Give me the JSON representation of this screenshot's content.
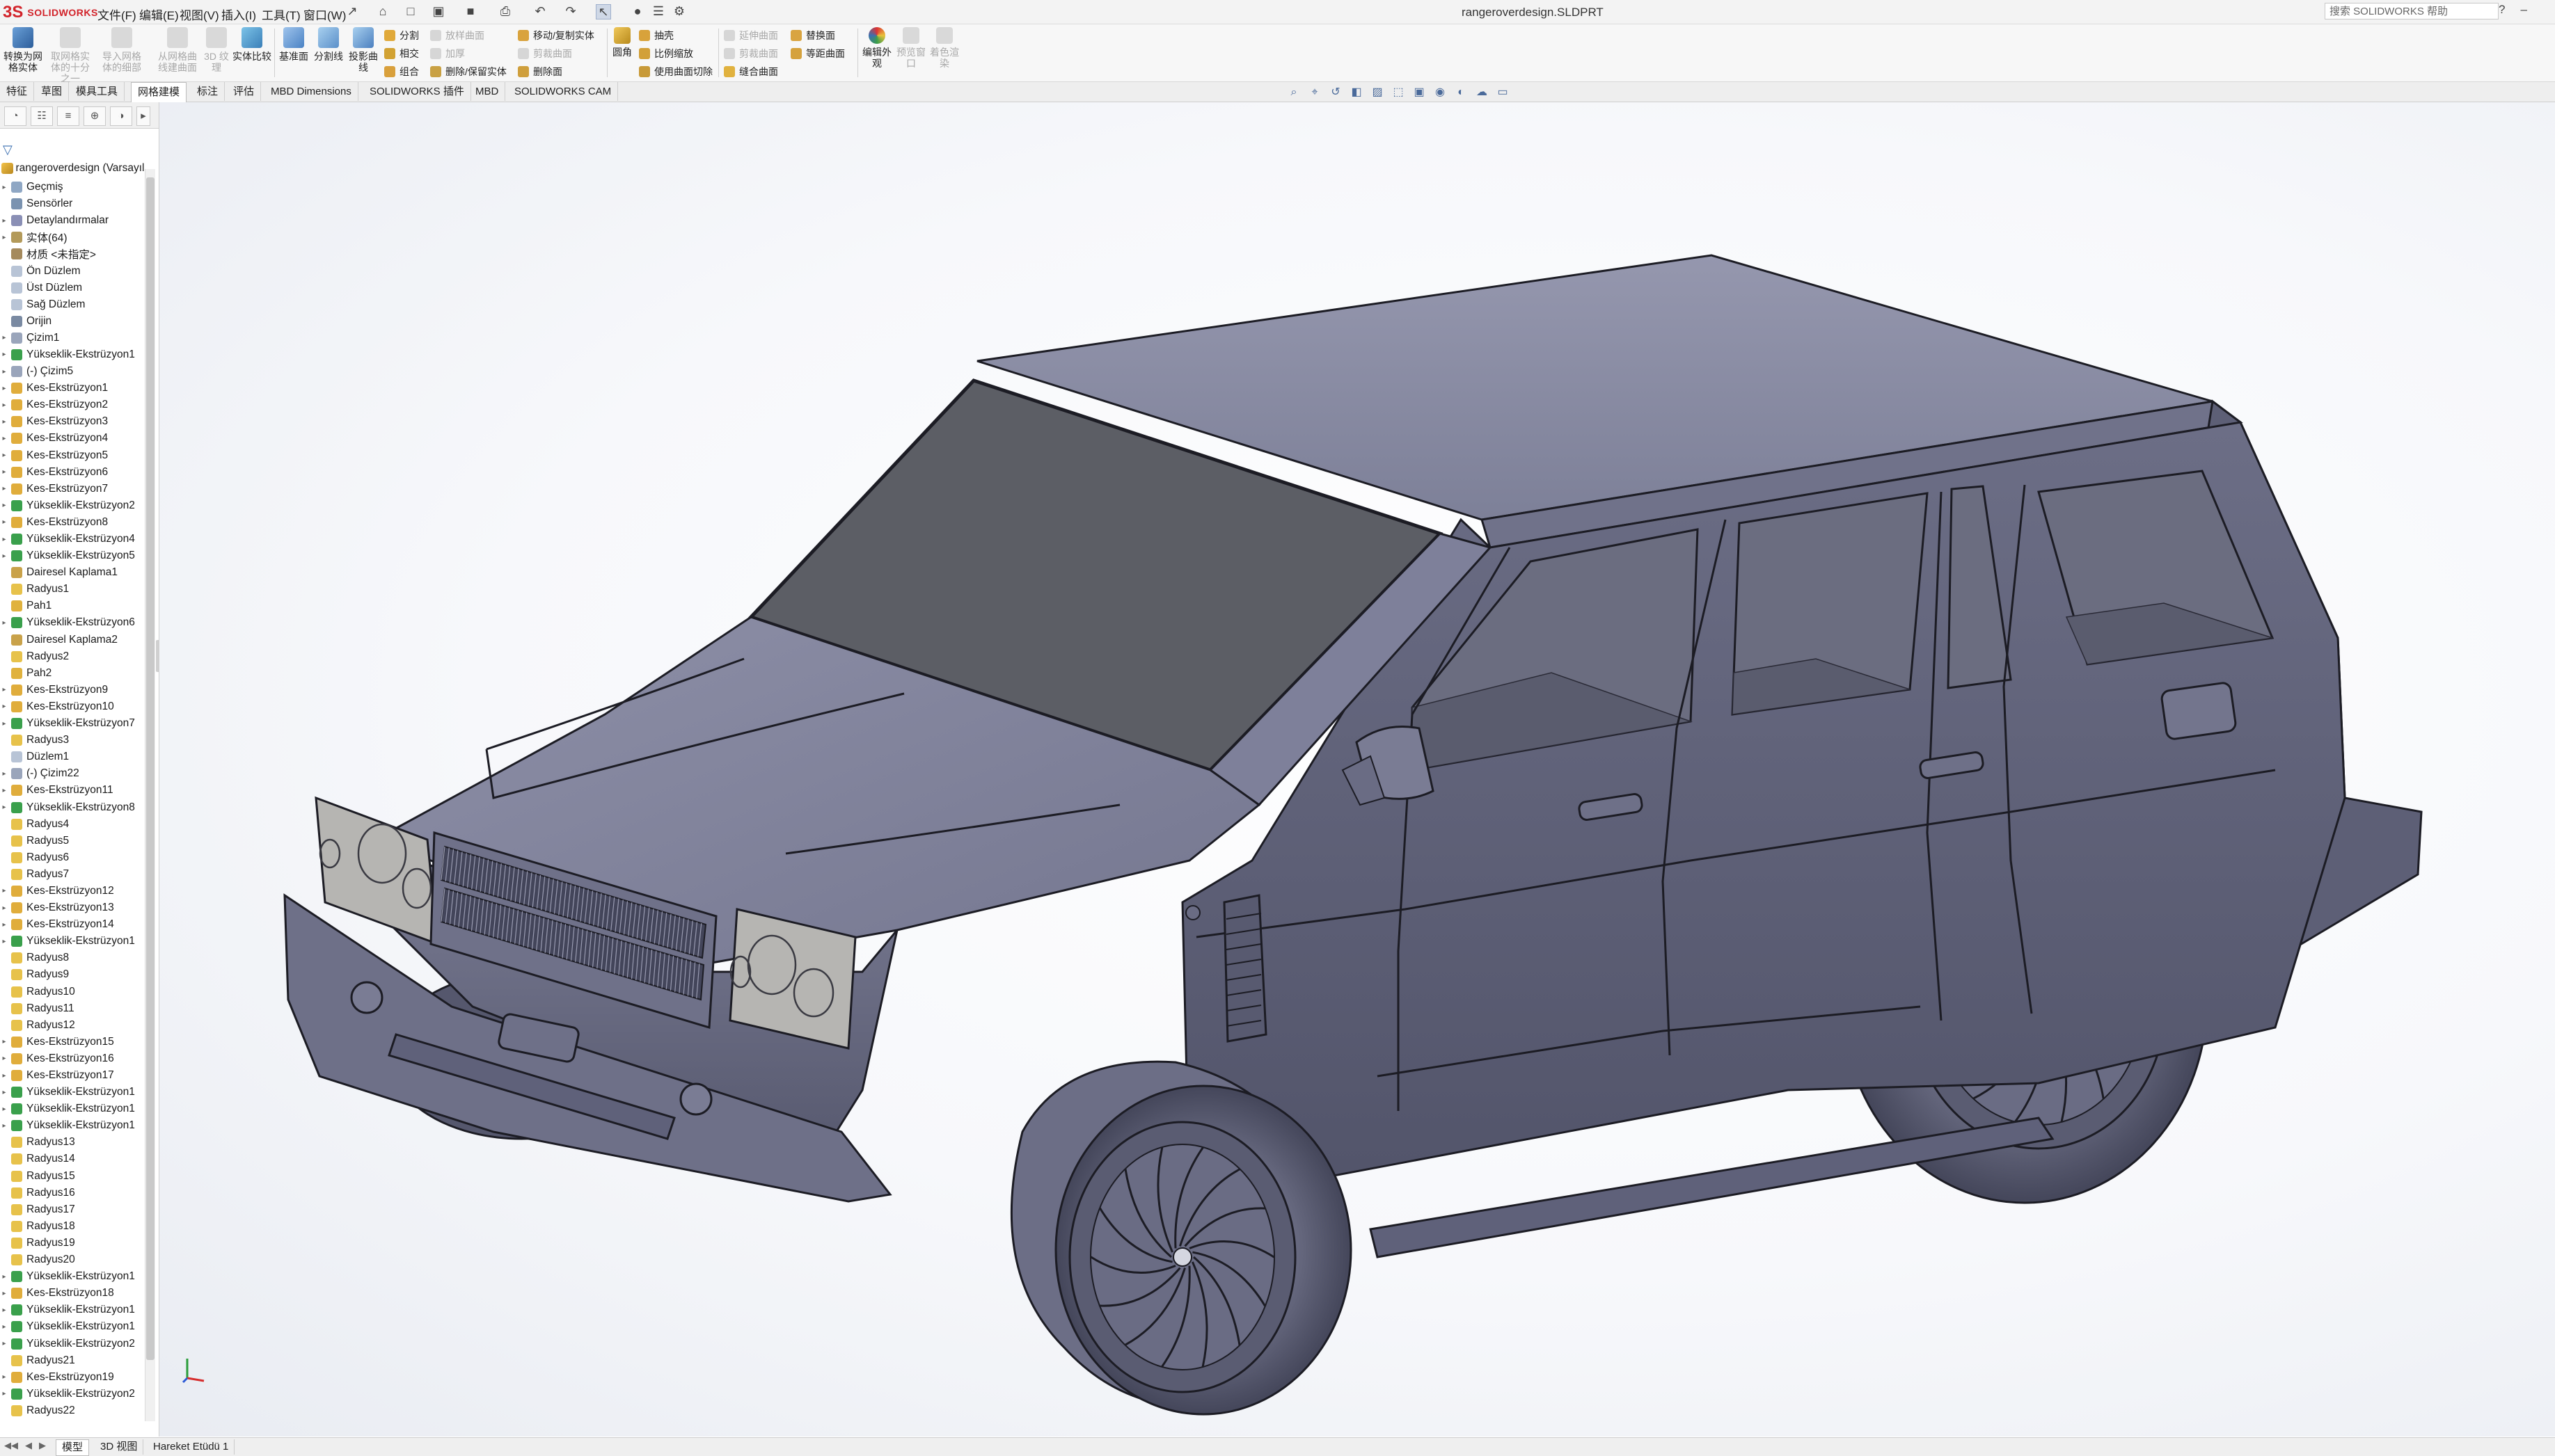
{
  "app": {
    "brand": "SOLIDWORKS",
    "logo_mark": "3S"
  },
  "menubar": {
    "items": [
      "文件(F)",
      "编辑(E)",
      "视图(V)",
      "插入(I)",
      "工具(T)",
      "窗口(W)"
    ],
    "document_title": "rangeroverdesign.SLDPRT",
    "search_placeholder": "搜索 SOLIDWORKS 帮助"
  },
  "command_manager": {
    "big_buttons": [
      {
        "label": "转换为网格实体",
        "enabled": true
      },
      {
        "label": "取网格实体的十分之一",
        "enabled": false
      },
      {
        "label": "导入网格体的细部",
        "enabled": false
      },
      {
        "label": "从网格曲线建曲面",
        "enabled": false
      },
      {
        "label": "3D 纹理",
        "enabled": false
      },
      {
        "label": "实体比较",
        "enabled": true
      },
      {
        "label": "基准面",
        "enabled": true
      },
      {
        "label": "分割线",
        "enabled": true
      },
      {
        "label": "投影曲线",
        "enabled": true
      }
    ],
    "small_buttons": [
      {
        "label": "分割",
        "enabled": true
      },
      {
        "label": "移动/复制实体",
        "enabled": true
      },
      {
        "label": "相交",
        "enabled": true
      },
      {
        "label": "删除/保留实体",
        "enabled": true
      },
      {
        "label": "组合",
        "enabled": true
      },
      {
        "label": "删除面",
        "enabled": true
      },
      {
        "label": "圆角",
        "enabled": true
      },
      {
        "label": "抽壳",
        "enabled": true
      },
      {
        "label": "比例缩放",
        "enabled": true
      },
      {
        "label": "使用曲面切除",
        "enabled": true
      },
      {
        "label": "替换面",
        "enabled": true
      },
      {
        "label": "等距曲面",
        "enabled": true
      },
      {
        "label": "缝合曲面",
        "enabled": true
      },
      {
        "label": "放样曲面",
        "enabled": false
      },
      {
        "label": "加厚",
        "enabled": false
      },
      {
        "label": "剪裁曲面",
        "enabled": false
      },
      {
        "label": "延伸曲面",
        "enabled": false
      }
    ],
    "right_buttons": [
      {
        "label": "编辑外观",
        "enabled": true
      },
      {
        "label": "预览窗口",
        "enabled": false
      },
      {
        "label": "着色渲染",
        "enabled": false
      }
    ]
  },
  "tabs": {
    "items": [
      "特征",
      "草图",
      "模具工具",
      "网格建模",
      "标注",
      "评估",
      "MBD Dimensions",
      "SOLIDWORKS 插件",
      "MBD",
      "SOLIDWORKS CAM"
    ],
    "active_index": 3
  },
  "feature_tree": {
    "root": "rangeroverdesign (Varsayılan",
    "nodes": [
      {
        "label": "Geçmiş",
        "icon": "history",
        "expandable": true
      },
      {
        "label": "Sensörler",
        "icon": "sensor",
        "expandable": false
      },
      {
        "label": "Detaylandırmalar",
        "icon": "annotation",
        "expandable": true
      },
      {
        "label": "实体(64)",
        "icon": "solid-bodies",
        "expandable": true
      },
      {
        "label": "材质 <未指定>",
        "icon": "material",
        "expandable": false
      },
      {
        "label": "Ön Düzlem",
        "icon": "plane",
        "expandable": false
      },
      {
        "label": "Üst Düzlem",
        "icon": "plane",
        "expandable": false
      },
      {
        "label": "Sağ Düzlem",
        "icon": "plane",
        "expandable": false
      },
      {
        "label": "Orijin",
        "icon": "origin",
        "expandable": false
      },
      {
        "label": "Çizim1",
        "icon": "sketch",
        "expandable": true
      },
      {
        "label": "Yükseklik-Ekstrüzyon1",
        "icon": "boss",
        "expandable": true
      },
      {
        "label": "(-) Çizim5",
        "icon": "sketch",
        "expandable": true
      },
      {
        "label": "Kes-Ekstrüzyon1",
        "icon": "cut",
        "expandable": true
      },
      {
        "label": "Kes-Ekstrüzyon2",
        "icon": "cut",
        "expandable": true
      },
      {
        "label": "Kes-Ekstrüzyon3",
        "icon": "cut",
        "expandable": true
      },
      {
        "label": "Kes-Ekstrüzyon4",
        "icon": "cut",
        "expandable": true
      },
      {
        "label": "Kes-Ekstrüzyon5",
        "icon": "cut",
        "expandable": true
      },
      {
        "label": "Kes-Ekstrüzyon6",
        "icon": "cut",
        "expandable": true
      },
      {
        "label": "Kes-Ekstrüzyon7",
        "icon": "cut",
        "expandable": true
      },
      {
        "label": "Yükseklik-Ekstrüzyon2",
        "icon": "boss",
        "expandable": true
      },
      {
        "label": "Kes-Ekstrüzyon8",
        "icon": "cut",
        "expandable": true
      },
      {
        "label": "Yükseklik-Ekstrüzyon4",
        "icon": "boss",
        "expandable": true
      },
      {
        "label": "Yükseklik-Ekstrüzyon5",
        "icon": "boss",
        "expandable": true
      },
      {
        "label": "Dairesel Kaplama1",
        "icon": "pattern",
        "expandable": false
      },
      {
        "label": "Radyus1",
        "icon": "fillet",
        "expandable": false
      },
      {
        "label": "Pah1",
        "icon": "chamfer",
        "expandable": false
      },
      {
        "label": "Yükseklik-Ekstrüzyon6",
        "icon": "boss",
        "expandable": true
      },
      {
        "label": "Dairesel Kaplama2",
        "icon": "pattern",
        "expandable": false
      },
      {
        "label": "Radyus2",
        "icon": "fillet",
        "expandable": false
      },
      {
        "label": "Pah2",
        "icon": "chamfer",
        "expandable": false
      },
      {
        "label": "Kes-Ekstrüzyon9",
        "icon": "cut",
        "expandable": true
      },
      {
        "label": "Kes-Ekstrüzyon10",
        "icon": "cut",
        "expandable": true
      },
      {
        "label": "Yükseklik-Ekstrüzyon7",
        "icon": "boss",
        "expandable": true
      },
      {
        "label": "Radyus3",
        "icon": "fillet",
        "expandable": false
      },
      {
        "label": "Düzlem1",
        "icon": "plane",
        "expandable": false
      },
      {
        "label": "(-) Çizim22",
        "icon": "sketch",
        "expandable": true
      },
      {
        "label": "Kes-Ekstrüzyon11",
        "icon": "cut",
        "expandable": true
      },
      {
        "label": "Yükseklik-Ekstrüzyon8",
        "icon": "boss",
        "expandable": true
      },
      {
        "label": "Radyus4",
        "icon": "fillet",
        "expandable": false
      },
      {
        "label": "Radyus5",
        "icon": "fillet",
        "expandable": false
      },
      {
        "label": "Radyus6",
        "icon": "fillet",
        "expandable": false
      },
      {
        "label": "Radyus7",
        "icon": "fillet",
        "expandable": false
      },
      {
        "label": "Kes-Ekstrüzyon12",
        "icon": "cut",
        "expandable": true
      },
      {
        "label": "Kes-Ekstrüzyon13",
        "icon": "cut",
        "expandable": true
      },
      {
        "label": "Kes-Ekstrüzyon14",
        "icon": "cut",
        "expandable": true
      },
      {
        "label": "Yükseklik-Ekstrüzyon1",
        "icon": "boss",
        "expandable": true
      },
      {
        "label": "Radyus8",
        "icon": "fillet",
        "expandable": false
      },
      {
        "label": "Radyus9",
        "icon": "fillet",
        "expandable": false
      },
      {
        "label": "Radyus10",
        "icon": "fillet",
        "expandable": false
      },
      {
        "label": "Radyus11",
        "icon": "fillet",
        "expandable": false
      },
      {
        "label": "Radyus12",
        "icon": "fillet",
        "expandable": false
      },
      {
        "label": "Kes-Ekstrüzyon15",
        "icon": "cut",
        "expandable": true
      },
      {
        "label": "Kes-Ekstrüzyon16",
        "icon": "cut",
        "expandable": true
      },
      {
        "label": "Kes-Ekstrüzyon17",
        "icon": "cut",
        "expandable": true
      },
      {
        "label": "Yükseklik-Ekstrüzyon1",
        "icon": "boss",
        "expandable": true
      },
      {
        "label": "Yükseklik-Ekstrüzyon1",
        "icon": "boss",
        "expandable": true
      },
      {
        "label": "Yükseklik-Ekstrüzyon1",
        "icon": "boss",
        "expandable": true
      },
      {
        "label": "Radyus13",
        "icon": "fillet",
        "expandable": false
      },
      {
        "label": "Radyus14",
        "icon": "fillet",
        "expandable": false
      },
      {
        "label": "Radyus15",
        "icon": "fillet",
        "expandable": false
      },
      {
        "label": "Radyus16",
        "icon": "fillet",
        "expandable": false
      },
      {
        "label": "Radyus17",
        "icon": "fillet",
        "expandable": false
      },
      {
        "label": "Radyus18",
        "icon": "fillet",
        "expandable": false
      },
      {
        "label": "Radyus19",
        "icon": "fillet",
        "expandable": false
      },
      {
        "label": "Radyus20",
        "icon": "fillet",
        "expandable": false
      },
      {
        "label": "Yükseklik-Ekstrüzyon1",
        "icon": "boss",
        "expandable": true
      },
      {
        "label": "Kes-Ekstrüzyon18",
        "icon": "cut",
        "expandable": true
      },
      {
        "label": "Yükseklik-Ekstrüzyon1",
        "icon": "boss",
        "expandable": true
      },
      {
        "label": "Yükseklik-Ekstrüzyon1",
        "icon": "boss",
        "expandable": true
      },
      {
        "label": "Yükseklik-Ekstrüzyon2",
        "icon": "boss",
        "expandable": true
      },
      {
        "label": "Radyus21",
        "icon": "fillet",
        "expandable": false
      },
      {
        "label": "Kes-Ekstrüzyon19",
        "icon": "cut",
        "expandable": true
      },
      {
        "label": "Yükseklik-Ekstrüzyon2",
        "icon": "boss",
        "expandable": true
      },
      {
        "label": "Radyus22",
        "icon": "fillet",
        "expandable": false
      }
    ]
  },
  "bottom_tabs": {
    "items": [
      "模型",
      "3D 视图",
      "Hareket Etüdü 1"
    ],
    "active_index": 0
  },
  "colors": {
    "body": "#6e7088",
    "body_dark": "#4e5066",
    "body_light": "#8f92a8",
    "glass": "#5d5f66",
    "edge": "#1c1c24",
    "accent_blue": "#3b6fb0",
    "brand_red": "#d2232a"
  }
}
